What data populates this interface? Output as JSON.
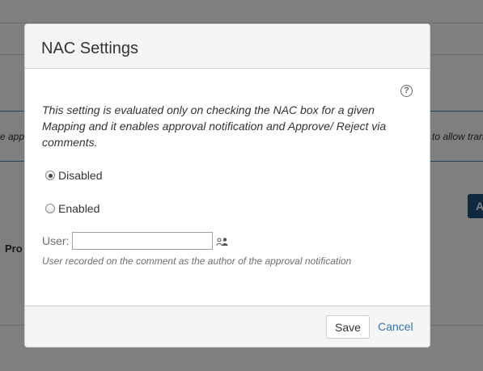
{
  "background": {
    "left_fragment": "e appr",
    "right_fragment": "to allow tran",
    "project_label": "Pro",
    "action_button_label": "A"
  },
  "dialog": {
    "title": "NAC Settings",
    "help_icon_glyph": "?",
    "description": "This setting is evaluated only on checking the NAC box for a given Mapping and it enables approval notification and Approve/ Reject via comments.",
    "options": [
      {
        "label": "Disabled",
        "selected": true
      },
      {
        "label": "Enabled",
        "selected": false
      }
    ],
    "user_field": {
      "label": "User:",
      "value": "",
      "picker_icon": "user-picker-icon",
      "helper": "User recorded on the comment as the author of the approval notification"
    },
    "footer": {
      "save_label": "Save",
      "cancel_label": "Cancel"
    }
  },
  "colors": {
    "link": "#3b73af",
    "overlay": "rgba(0,0,0,0.5)",
    "header_bg": "#f5f5f5",
    "bg_accent": "#205081"
  }
}
